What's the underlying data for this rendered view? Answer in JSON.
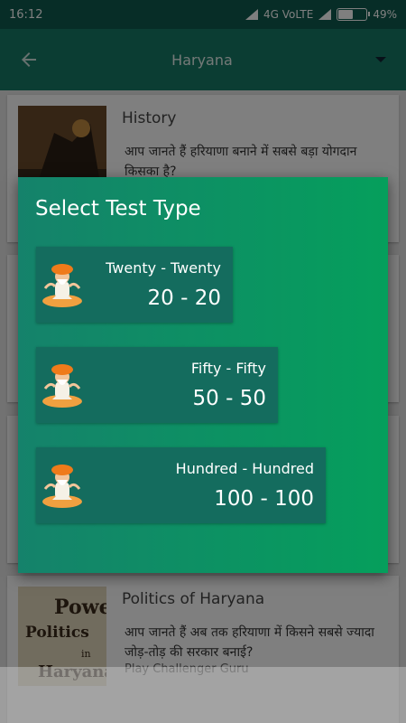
{
  "status_bar": {
    "time": "16:12",
    "network": "4G VoLTE",
    "battery": "49%",
    "battery_level": 0.49
  },
  "app_bar": {
    "title": "Haryana",
    "back_icon": "arrow-left-icon",
    "dropdown_icon": "caret-down-icon"
  },
  "cards": [
    {
      "title": "History",
      "description": "आप जानते हैं हरियाणा बनाने में सबसे बड़ा योगदान किसका है?",
      "footer": ""
    },
    {
      "title": "Politics of Haryana",
      "description": "आप जानते हैं अब तक हरियाणा में किसने सबसे ज्यादा जोड़-तोड़ की सरकार बनाई?",
      "footer": "Play Challenger Guru",
      "thumb_text": [
        "Power",
        "Politics",
        "in",
        "Haryana"
      ]
    }
  ],
  "dialog": {
    "title": "Select Test Type",
    "options": [
      {
        "label": "Twenty - Twenty",
        "value": "20 - 20"
      },
      {
        "label": "Fifty - Fifty",
        "value": "50 - 50"
      },
      {
        "label": "Hundred - Hundred",
        "value": "100 - 100"
      }
    ]
  },
  "colors": {
    "status_bar": "#0f5a4e",
    "app_bar": "#167a67",
    "dialog_left": "#15826b",
    "dialog_right": "#059f5c",
    "option_bg": "#146c5e"
  }
}
